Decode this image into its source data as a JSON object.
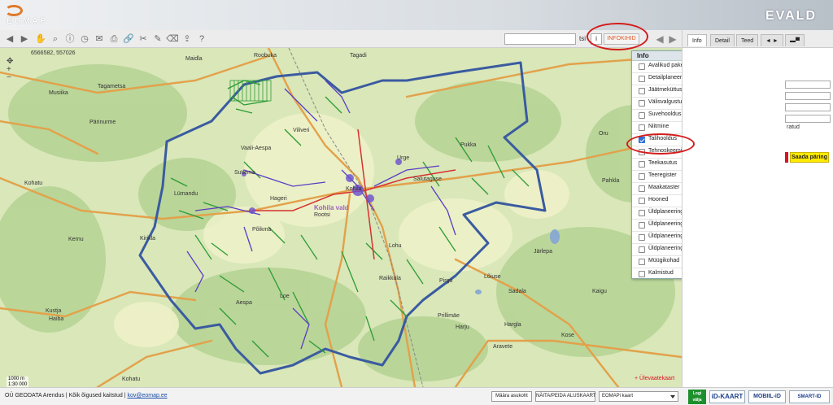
{
  "header": {
    "brand": "EOMAP",
    "app_name": "EVALD"
  },
  "toolbar": {
    "icons": [
      "back-icon",
      "forward-icon",
      "hand-icon",
      "zoom-icon",
      "info-icon",
      "clock-icon",
      "mail-icon",
      "print-icon",
      "link-icon",
      "scissors-icon",
      "pencil-icon",
      "eraser-icon",
      "export-icon",
      "help-icon"
    ],
    "search_value": "",
    "small_label": "tsi",
    "i_label": "i",
    "infokihid_label": "INFOKIHID"
  },
  "map": {
    "coordinates": "6566582, 557026",
    "place_labels": [
      {
        "text": "Roobuka",
        "big": false
      },
      {
        "text": "Maidla",
        "big": false
      },
      {
        "text": "Tagadi",
        "big": false
      },
      {
        "text": "Tagametsa",
        "big": false
      },
      {
        "text": "Musiika",
        "big": false
      },
      {
        "text": "Pärinurme",
        "big": false
      },
      {
        "text": "Viliveri",
        "big": false
      },
      {
        "text": "Kohatu",
        "big": false
      },
      {
        "text": "Lümandu",
        "big": false
      },
      {
        "text": "Sutlema",
        "big": false
      },
      {
        "text": "Vaali-Aespa",
        "big": false
      },
      {
        "text": "Hageri",
        "big": false
      },
      {
        "text": "Kohila",
        "big": false
      },
      {
        "text": "Kohila vald",
        "big": true
      },
      {
        "text": "Rootsi",
        "big": false
      },
      {
        "text": "Põikma",
        "big": false
      },
      {
        "text": "Aespa",
        "big": false
      },
      {
        "text": "Kirikla",
        "big": false
      },
      {
        "text": "Kernu",
        "big": false
      },
      {
        "text": "Haiba",
        "big": false
      },
      {
        "text": "Kustja",
        "big": false
      },
      {
        "text": "Loe",
        "big": false
      },
      {
        "text": "Urge",
        "big": false
      },
      {
        "text": "Salutaguse",
        "big": false
      },
      {
        "text": "Pukka",
        "big": false
      },
      {
        "text": "Oru",
        "big": false
      },
      {
        "text": "Pahkla",
        "big": false
      },
      {
        "text": "Järlepa",
        "big": false
      },
      {
        "text": "Lohu",
        "big": false
      },
      {
        "text": "Pirgu",
        "big": false
      },
      {
        "text": "Lõiuse",
        "big": false
      },
      {
        "text": "Sadala",
        "big": false
      },
      {
        "text": "Kaigu",
        "big": false
      },
      {
        "text": "Prillimäe",
        "big": false
      },
      {
        "text": "Raikküla",
        "big": false
      },
      {
        "text": "Harju",
        "big": false
      },
      {
        "text": "Hargla",
        "big": false
      },
      {
        "text": "Kose",
        "big": false
      },
      {
        "text": "Kohatu",
        "big": false
      },
      {
        "text": "Aravete",
        "big": false
      }
    ],
    "scale_text": "1000 m\n1:30 000",
    "overview_link": "+ Ülevaatekaart"
  },
  "info_panel": {
    "title": "Info",
    "layers": [
      {
        "name": "Avalikud pakendikonteinerid",
        "checked": false
      },
      {
        "name": "Detailplaneeringud",
        "checked": false
      },
      {
        "name": "Jäätmeküttus",
        "checked": false
      },
      {
        "name": "Välisvalgustus",
        "checked": false
      },
      {
        "name": "Suvehooldus",
        "checked": false
      },
      {
        "name": "Niitmine",
        "checked": false
      },
      {
        "name": "Talihooldus",
        "checked": true
      },
      {
        "name": "Tehnoskeemid",
        "checked": false
      },
      {
        "name": "Teekasutus",
        "checked": false
      },
      {
        "name": "Teeregister",
        "checked": false
      },
      {
        "name": "Maakataster",
        "checked": false
      },
      {
        "name": "Hooned",
        "checked": false
      },
      {
        "name": "Üldplaneering - Maakasutus",
        "checked": false
      },
      {
        "name": "Üldplaneering - Piirangud",
        "checked": false
      },
      {
        "name": "Üldplaneering - Loodus- ja muinsuskaitse",
        "checked": false
      },
      {
        "name": "Üldplaneering - Piirid",
        "checked": false
      },
      {
        "name": "Müügikohad",
        "checked": false
      },
      {
        "name": "Kalmistud",
        "checked": false
      }
    ]
  },
  "side": {
    "tabs": [
      {
        "label": "Info",
        "active": true
      },
      {
        "label": "Detail",
        "active": false
      },
      {
        "label": "Teed",
        "active": false
      },
      {
        "label": "◄ ►",
        "active": false
      },
      {
        "label": "▬▀",
        "active": false
      }
    ],
    "partial_text": "ratud",
    "submit_label": "Saada päring"
  },
  "footer": {
    "copyright": "OÜ GEODATA Arendus | Kõik õigused kaitstud |",
    "email": "kov@eomap.ee",
    "locate_label": "Määra asukoht",
    "basemap_button": "NÄITA/PEIDA ALUSKAART",
    "basemap_select": "EOMAPi kaart",
    "logout_label": "Logi välja",
    "idkaart_label": "iD-KAART",
    "mobiil_label": "MOBIIL-iD",
    "smart_label": "SMART-ID"
  }
}
